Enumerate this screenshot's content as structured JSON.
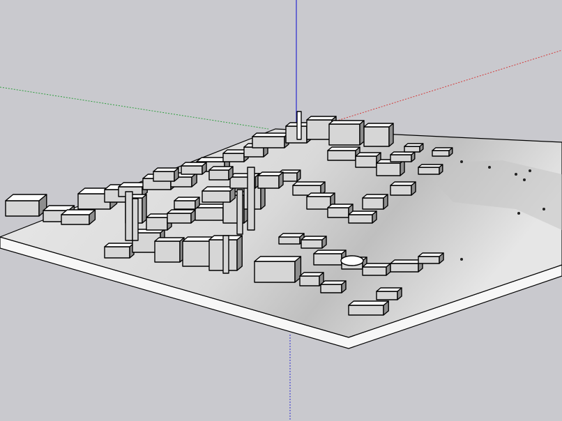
{
  "app": {
    "view": "perspective-3d-model-viewport"
  },
  "scene": {
    "background_color": "#c9c9ce",
    "axes": {
      "red_color": "#d33a3a",
      "green_color": "#2e9e3e",
      "blue_color": "#2a2ad0"
    },
    "model": {
      "base_top_color": "#e4e4e4",
      "base_side_color": "#f7f7f7",
      "building_roof_color": "#ffffff",
      "building_side_color": "#d6d6d6",
      "building_shadow_color": "#8e8e8e",
      "terrain_shade_color": "#bdbdbd"
    }
  }
}
